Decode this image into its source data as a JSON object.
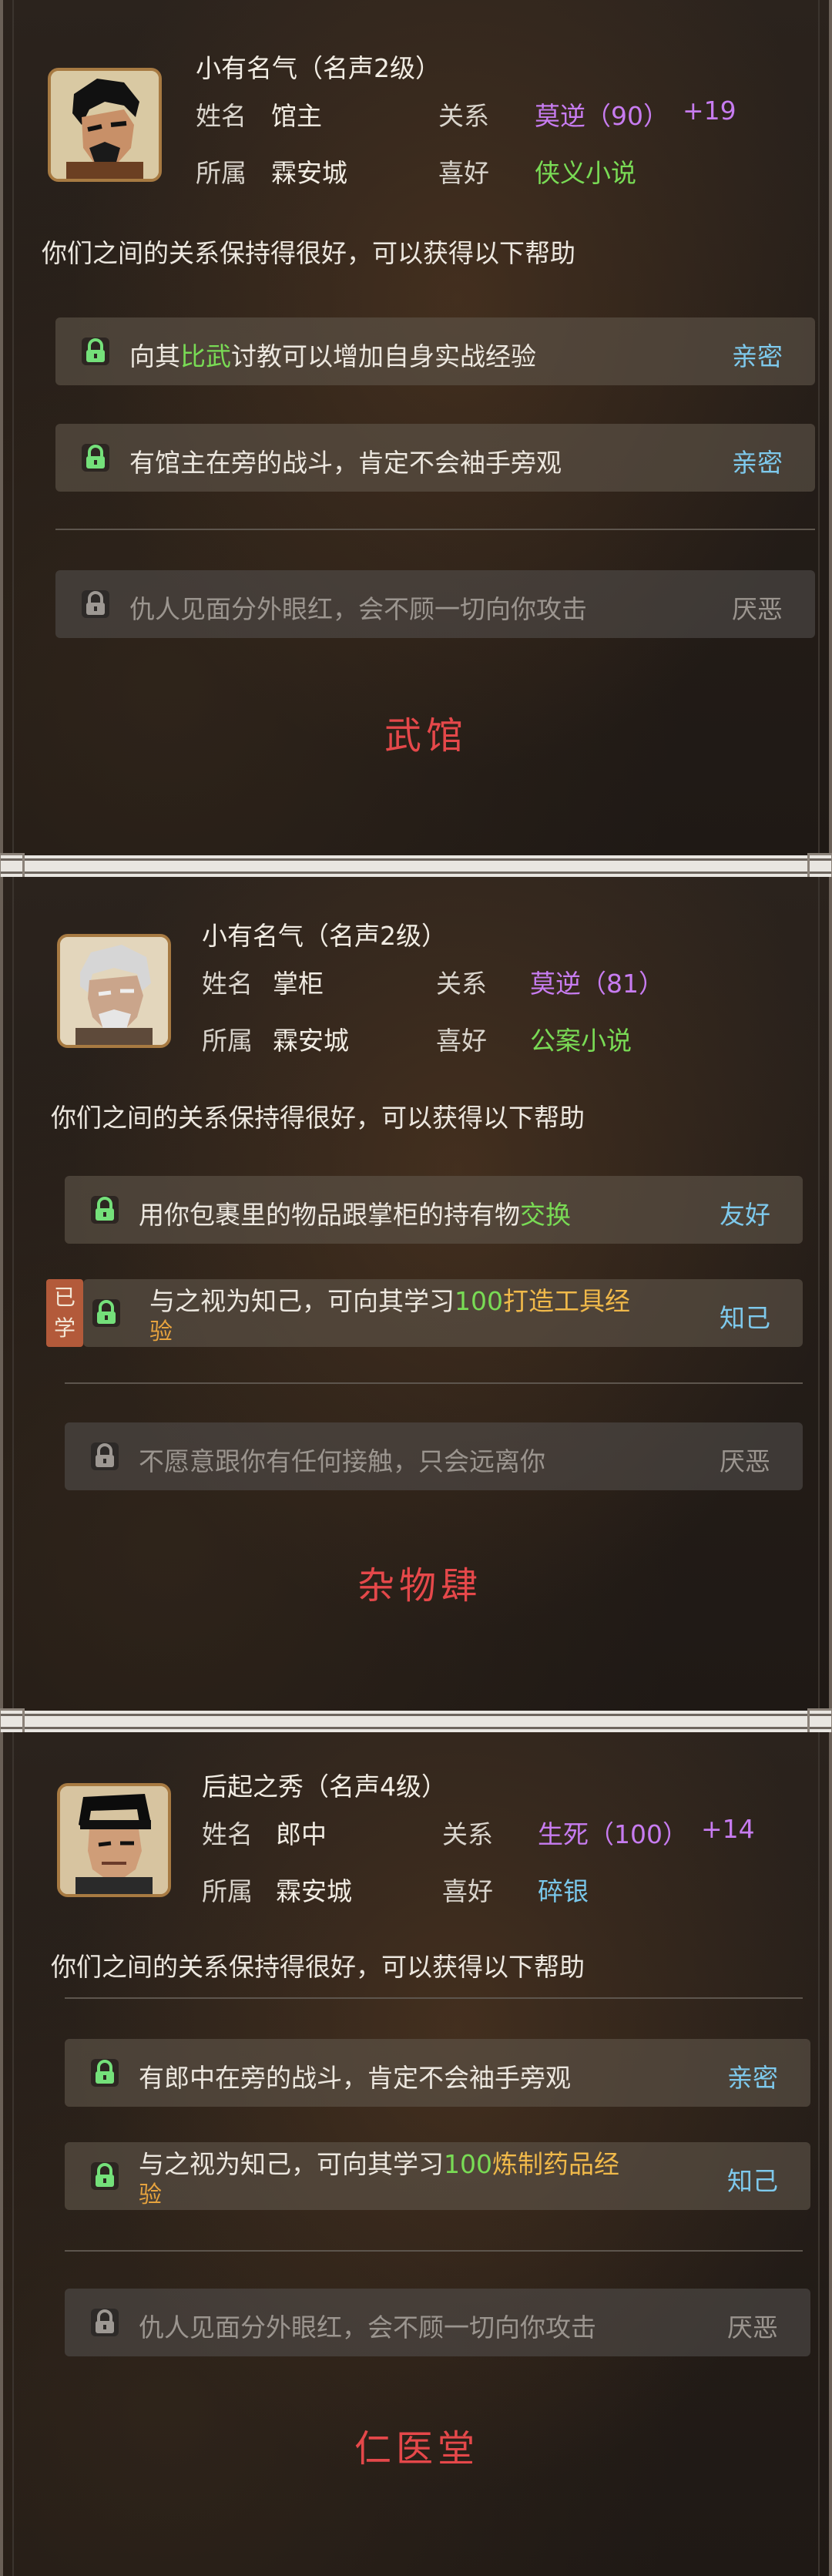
{
  "cards": [
    {
      "fame": "小有名气（名声2级）",
      "name_label": "姓名",
      "name": "馆主",
      "relation_label": "关系",
      "relation": "莫逆（90）",
      "relation_bonus": "+19",
      "faction_label": "所属",
      "faction": "霖安城",
      "hobby_label": "喜好",
      "hobby": "侠义小说",
      "intro": "你们之间的关系保持得很好，可以获得以下帮助",
      "benefits": [
        {
          "pre": "向其",
          "hl": "比武",
          "post": "讨教可以增加自身实战经验",
          "tag": "亲密"
        },
        {
          "pre": "有馆主在旁的战斗，肯定不会袖手旁观",
          "hl": "",
          "post": "",
          "tag": "亲密"
        }
      ],
      "hostile": {
        "text": "仇人见面分外眼红，会不顾一切向你攻击",
        "tag": "厌恶"
      },
      "caption": "武馆",
      "colors": {
        "relation": "#c77cf0",
        "hobby": "#79db55"
      }
    },
    {
      "fame": "小有名气（名声2级）",
      "name_label": "姓名",
      "name": "掌柜",
      "relation_label": "关系",
      "relation": "莫逆（81）",
      "relation_bonus": "",
      "faction_label": "所属",
      "faction": "霖安城",
      "hobby_label": "喜好",
      "hobby": "公案小说",
      "intro": "你们之间的关系保持得很好，可以获得以下帮助",
      "benefits": [
        {
          "pre": "用你包裹里的物品跟掌柜的持有物",
          "hl": "交换",
          "post": "",
          "tag": "友好"
        },
        {
          "pre": "与之视为知己，可向其学习",
          "num": "100",
          "hl": "打造工具经",
          "post2": "验",
          "tag": "知己",
          "learned": "已学"
        }
      ],
      "hostile": {
        "text": "不愿意跟你有任何接触，只会远离你",
        "tag": "厌恶"
      },
      "caption": "杂物肆",
      "colors": {
        "relation": "#c77cf0",
        "hobby": "#79db55"
      }
    },
    {
      "fame": "后起之秀（名声4级）",
      "name_label": "姓名",
      "name": "郎中",
      "relation_label": "关系",
      "relation": "生死（100）",
      "relation_bonus": "+14",
      "faction_label": "所属",
      "faction": "霖安城",
      "hobby_label": "喜好",
      "hobby": "碎银",
      "intro": "你们之间的关系保持得很好，可以获得以下帮助",
      "benefits": [
        {
          "pre": "有郎中在旁的战斗，肯定不会袖手旁观",
          "hl": "",
          "post": "",
          "tag": "亲密"
        },
        {
          "pre": "与之视为知己，可向其学习",
          "num": "100",
          "hl": "炼制药品经",
          "post2": "验",
          "tag": "知己"
        }
      ],
      "hostile": {
        "text": "仇人见面分外眼红，会不顾一切向你攻击",
        "tag": "厌恶"
      },
      "caption": "仁医堂",
      "colors": {
        "relation": "#c77cf0",
        "hobby": "#79c7ea"
      }
    }
  ]
}
